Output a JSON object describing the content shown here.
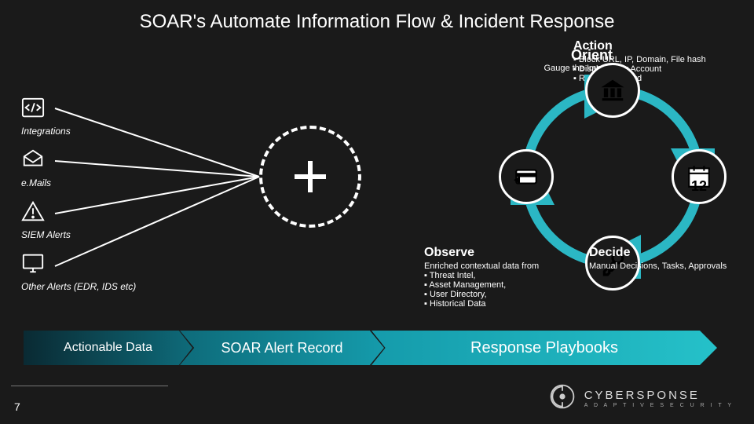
{
  "title": "SOAR's Automate Information Flow & Incident Response",
  "left_sources": {
    "integrations": "Integrations",
    "emails": "e.Mails",
    "siem": "SIEM Alerts",
    "other": "Other Alerts (EDR, IDS etc)"
  },
  "orient": {
    "heading": "Orient",
    "sub": "Gauge the Impact"
  },
  "action": {
    "heading": "Action",
    "items": [
      "Block URL, IP, Domain, File hash",
      "Disable User Account",
      "Reset Password"
    ]
  },
  "observe": {
    "heading": "Observe",
    "sub": "Enriched contextual data from",
    "items": [
      "Threat Intel,",
      "Asset Management,",
      "User Directory,",
      "Historical Data"
    ]
  },
  "decide": {
    "heading": "Decide",
    "sub": "Manual Decisions, Tasks, Approvals"
  },
  "orbit": {
    "calendar_num": "12"
  },
  "arrow": {
    "seg1": "Actionable Data",
    "seg2": "SOAR Alert Record",
    "seg3": "Response Playbooks"
  },
  "slide_number": "7",
  "logo": {
    "name": "CYBERSPONSE",
    "tag": "A D A P T I V E   S E C U R I T Y"
  }
}
